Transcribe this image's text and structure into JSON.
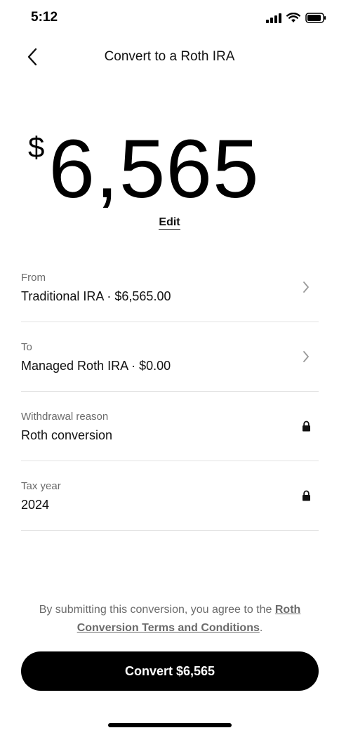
{
  "status_bar": {
    "time": "5:12"
  },
  "header": {
    "title": "Convert to a Roth IRA",
    "back_icon": "chevron-left-icon"
  },
  "amount": {
    "currency": "$",
    "value": "6,565",
    "edit_label": "Edit"
  },
  "rows": [
    {
      "label": "From",
      "value": "Traditional IRA · $6,565.00",
      "icon": "chevron-right-icon"
    },
    {
      "label": "To",
      "value": "Managed Roth IRA · $0.00",
      "icon": "chevron-right-icon"
    },
    {
      "label": "Withdrawal reason",
      "value": "Roth conversion",
      "icon": "lock-icon"
    },
    {
      "label": "Tax year",
      "value": "2024",
      "icon": "lock-icon"
    }
  ],
  "disclaimer": {
    "text": "By submitting this conversion, you agree to the ",
    "link": "Roth Conversion Terms and Conditions",
    "suffix": "."
  },
  "cta": {
    "label": "Convert $6,565"
  }
}
